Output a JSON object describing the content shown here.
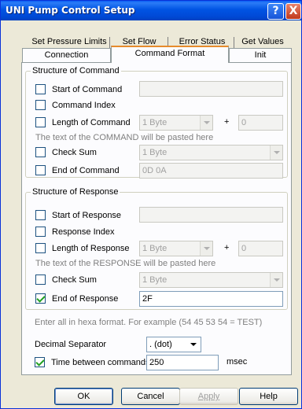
{
  "window": {
    "title": "UNI Pump Control Setup",
    "help_glyph": "?",
    "close_glyph": "X"
  },
  "tabs": {
    "row1": [
      "Set Pressure Limits",
      "Set Flow",
      "Error Status",
      "Get Values"
    ],
    "row2": [
      "Connection",
      "Command Format",
      "Init"
    ],
    "active": "Command Format"
  },
  "command": {
    "group_label": "Structure of Command",
    "start_label": "Start of Command",
    "start_value": "",
    "index_label": "Command Index",
    "length_label": "Length of Command",
    "length_select": "1 Byte",
    "plus": "+",
    "length_offset": "0",
    "note": "The text of the COMMAND will be pasted here",
    "checksum_label": "Check Sum",
    "checksum_select": "1 Byte",
    "end_label": "End of Command",
    "end_value": "0D 0A"
  },
  "response": {
    "group_label": "Structure of Response",
    "start_label": "Start of Response",
    "start_value": "",
    "index_label": "Response Index",
    "length_label": "Length of Response",
    "length_select": "1 Byte",
    "plus": "+",
    "length_offset": "0",
    "note": "The text of the RESPONSE will be pasted here",
    "checksum_label": "Check Sum",
    "checksum_select": "1 Byte",
    "end_label": "End of Response",
    "end_value": "2F",
    "end_checked": true
  },
  "footer": {
    "hex_note": "Enter all in hexa format. For example (54 45 53 54 = TEST)",
    "decimal_label": "Decimal Separator",
    "decimal_value": ". (dot)",
    "time_label": "Time between commands",
    "time_value": "250",
    "time_unit": "msec",
    "time_checked": true
  },
  "buttons": {
    "ok": "OK",
    "cancel": "Cancel",
    "apply": "Apply",
    "help": "Help"
  }
}
